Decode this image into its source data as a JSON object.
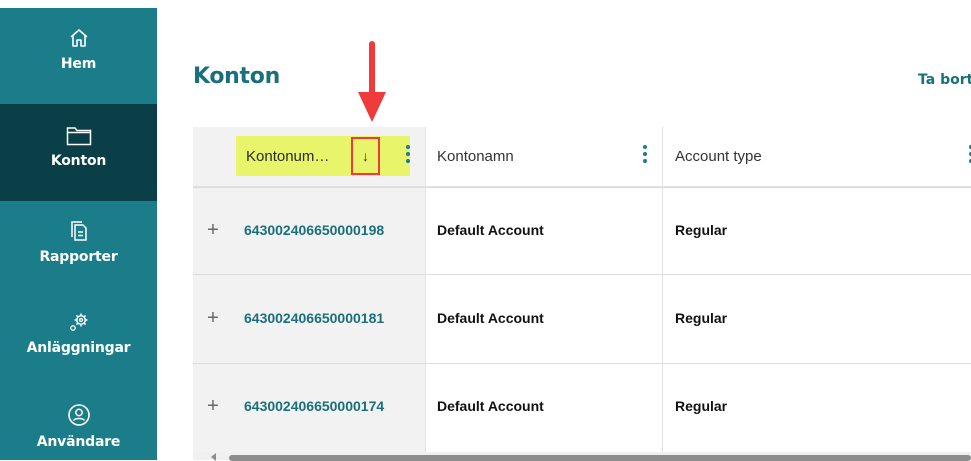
{
  "sidebar": {
    "items": [
      {
        "label": "Hem",
        "icon": "home-icon"
      },
      {
        "label": "Konton",
        "icon": "folder-icon",
        "active": true
      },
      {
        "label": "Rapporter",
        "icon": "document-copy-icon"
      },
      {
        "label": "Anläggningar",
        "icon": "gears-icon"
      },
      {
        "label": "Användare",
        "icon": "user-circle-icon"
      }
    ]
  },
  "page": {
    "title": "Konton",
    "top_link": "Ta bort"
  },
  "table": {
    "columns": [
      {
        "label": "Kontonum…",
        "sort": "descending",
        "sort_glyph": "↓"
      },
      {
        "label": "Kontonamn"
      },
      {
        "label": "Account type"
      }
    ],
    "expand_glyph": "+",
    "rows": [
      {
        "account_number": "643002406650000198",
        "account_name": "Default Account",
        "account_type": "Regular"
      },
      {
        "account_number": "643002406650000181",
        "account_name": "Default Account",
        "account_type": "Regular"
      },
      {
        "account_number": "643002406650000174",
        "account_name": "Default Account",
        "account_type": "Regular"
      }
    ]
  },
  "colors": {
    "sidebar": "#1a7d89",
    "sidebar_active": "#0b3f47",
    "accent_text": "#1a6f7c",
    "sort_column_highlight": "#e8f56a",
    "annotation_red": "#ef3b3b"
  }
}
